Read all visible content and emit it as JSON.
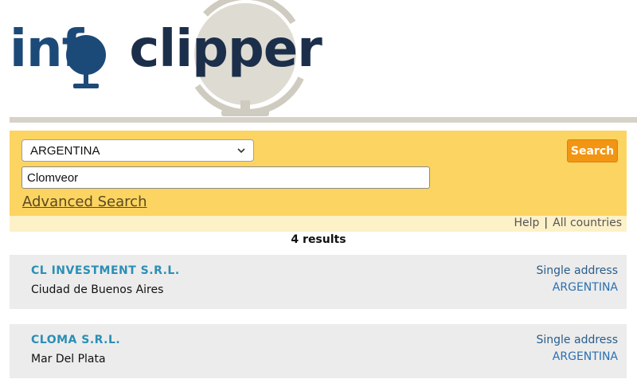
{
  "logo": {
    "part1": "inf",
    "part2": "clipper"
  },
  "search": {
    "country_selected": "ARGENTINA",
    "query_value": "Clomveor",
    "advanced_label": "Advanced Search",
    "button_label": "Search"
  },
  "help": {
    "help_label": "Help",
    "separator": "|",
    "all_countries_label": "All countries"
  },
  "results": {
    "count_label": "4 results",
    "items": [
      {
        "name": "CL INVESTMENT S.R.L.",
        "city": "Ciudad de Buenos Aires",
        "address_type": "Single address",
        "country": "ARGENTINA"
      },
      {
        "name": "CLOMA S.R.L.",
        "city": "Mar Del Plata",
        "address_type": "Single address",
        "country": "ARGENTINA"
      }
    ]
  },
  "colors": {
    "panel": "#fcd462",
    "button": "#f29513",
    "link": "#2a8fb6",
    "logo_blue": "#1c4a78"
  }
}
